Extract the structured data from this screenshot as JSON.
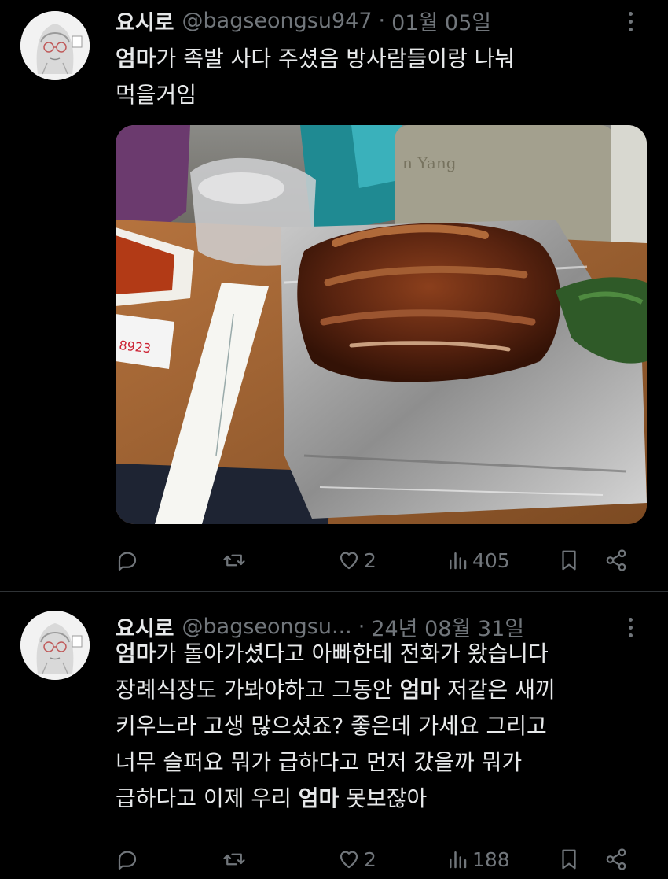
{
  "tweets": [
    {
      "author_name": "요시로",
      "handle": "@bagseongsu947",
      "separator": "·",
      "date": "01월 05일",
      "text_parts": [
        {
          "text": "엄마",
          "bold": true
        },
        {
          "text": "가 족발 사다 주셨음 방사람들이랑 나눠\n먹을거임",
          "bold": false
        }
      ],
      "replies": "",
      "retweets": "",
      "likes": "2",
      "views": "405",
      "media": {
        "watermark": "n Yang",
        "label_number": "8923"
      }
    },
    {
      "author_name": "요시로",
      "handle": "@bagseongsu...",
      "separator": "·",
      "date": "24년 08월 31일",
      "text_parts": [
        {
          "text": "엄마",
          "bold": true
        },
        {
          "text": "가 돌아가셨다고 아빠한테 전화가 왔습니다\n장례식장도 가봐야하고 그동안 ",
          "bold": false
        },
        {
          "text": "엄마",
          "bold": true
        },
        {
          "text": " 저같은 새끼\n키우느라 고생 많으셨죠? 좋은데 가세요 그리고\n너무 슬퍼요 뭐가 급하다고 먼저 갔을까 뭐가\n급하다고 이제 우리 ",
          "bold": false
        },
        {
          "text": "엄마",
          "bold": true
        },
        {
          "text": " 못보잖아",
          "bold": false
        }
      ],
      "replies": "",
      "retweets": "",
      "likes": "2",
      "views": "188"
    }
  ],
  "icons": {
    "reply": "reply-icon",
    "retweet": "retweet-icon",
    "like": "heart-icon",
    "views": "views-icon",
    "bookmark": "bookmark-icon",
    "share": "share-icon",
    "more": "more-icon"
  },
  "colors": {
    "background": "#000000",
    "text": "#e7e9ea",
    "secondary": "#71767b",
    "divider": "#2f3336"
  }
}
